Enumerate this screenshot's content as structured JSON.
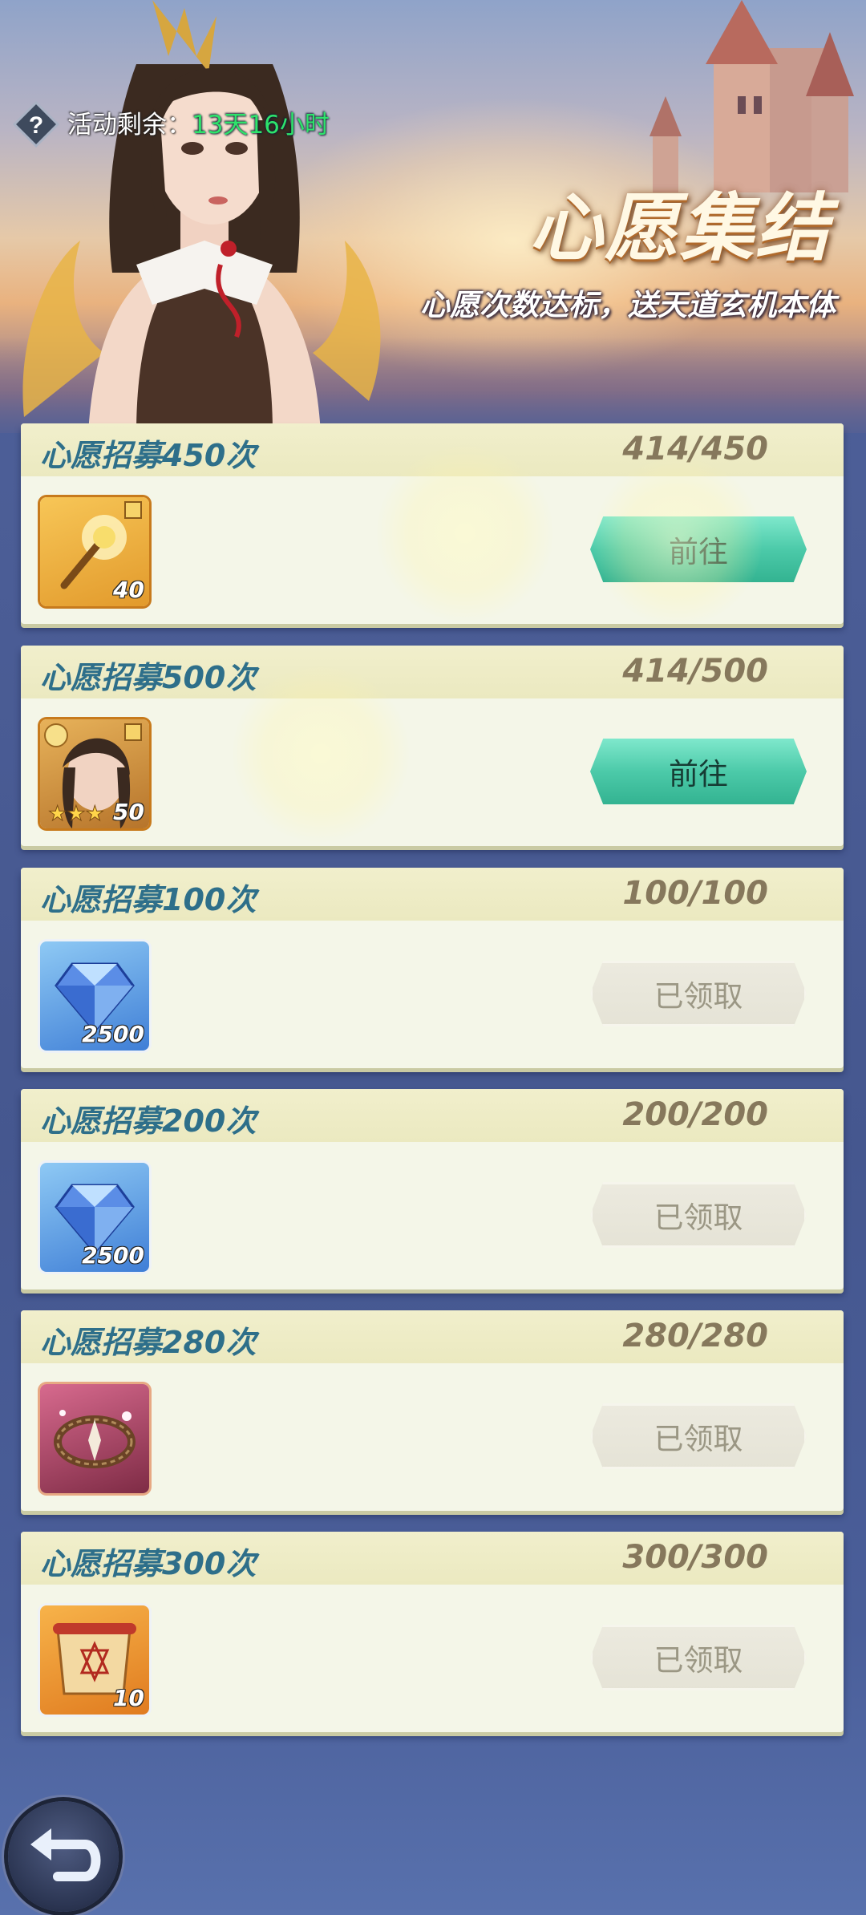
{
  "header": {
    "timer_label": "活动剩余：",
    "timer_value": "13天16小时",
    "title": "心愿集结",
    "subtitle": "心愿次数达标，送天道玄机本体"
  },
  "tasks": [
    {
      "title": "心愿招募450次",
      "progress": "414/450",
      "item_qty": "40",
      "item_icon": "golden-scepter-icon",
      "button": "前往",
      "state": "go"
    },
    {
      "title": "心愿招募500次",
      "progress": "414/500",
      "item_qty": "50",
      "item_icon": "hero-portrait-icon",
      "button": "前往",
      "state": "go"
    },
    {
      "title": "心愿招募100次",
      "progress": "100/100",
      "item_qty": "2500",
      "item_icon": "diamond-icon",
      "button": "已领取",
      "state": "claimed"
    },
    {
      "title": "心愿招募200次",
      "progress": "200/200",
      "item_qty": "2500",
      "item_icon": "diamond-icon",
      "button": "已领取",
      "state": "claimed"
    },
    {
      "title": "心愿招募280次",
      "progress": "280/280",
      "item_qty": "",
      "item_icon": "thorn-crown-icon",
      "button": "已领取",
      "state": "claimed"
    },
    {
      "title": "心愿招募300次",
      "progress": "300/300",
      "item_qty": "10",
      "item_icon": "scroll-icon",
      "button": "已领取",
      "state": "claimed"
    }
  ],
  "colors": {
    "title_blue": "#2e6f8a",
    "progress_brown": "#86785c",
    "go_green": "#4ccaa9",
    "timer_green": "#2ee36b"
  }
}
